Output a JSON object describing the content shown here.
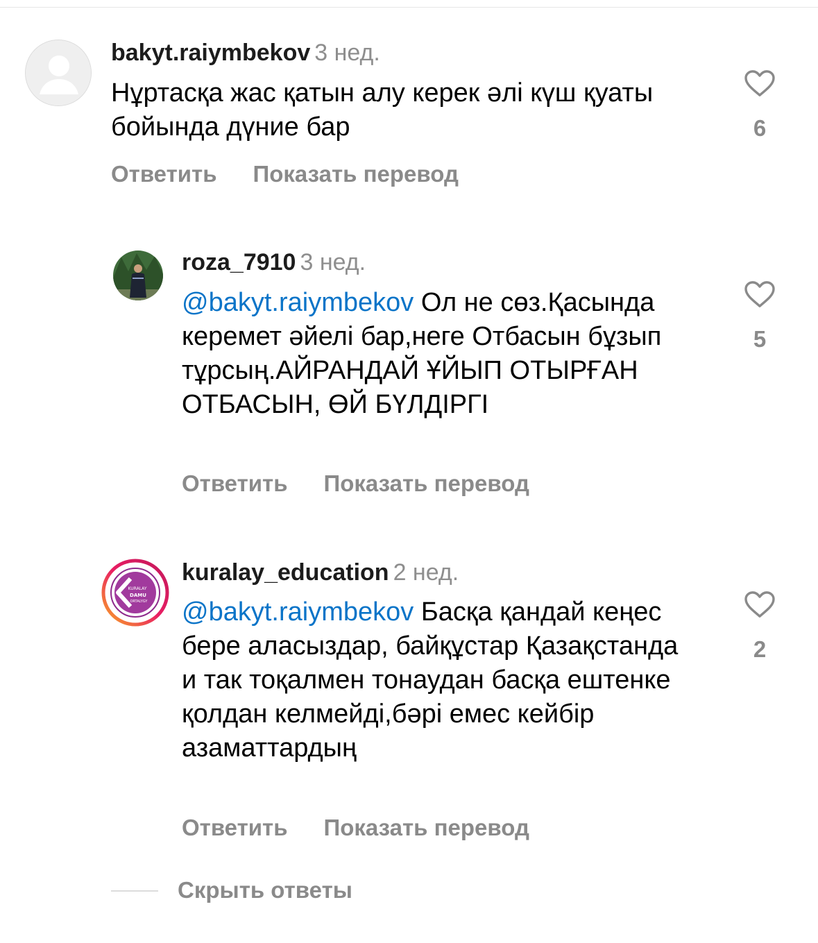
{
  "comments": [
    {
      "username": "bakyt.raiymbekov",
      "time": "3 нед.",
      "mention": "",
      "text": "Нұртасқа жас қатын алу керек әлі күш қуаты бойында дүние бар",
      "likes": "6",
      "reply_label": "Ответить",
      "translate_label": "Показать перевод"
    },
    {
      "username": "roza_7910",
      "time": "3 нед.",
      "mention": "@bakyt.raiymbekov",
      "text": "Ол не сөз.Қасында керемет әйелі бар,неге Отбасын бұзып тұрсың.АЙРАНДАЙ ҰЙЫП ОТЫРҒАН ОТБАСЫН, ӨЙ БҮЛДІРГІ",
      "likes": "5",
      "reply_label": "Ответить",
      "translate_label": "Показать перевод"
    },
    {
      "username": "kuralay_education",
      "time": "2 нед.",
      "mention": "@bakyt.raiymbekov",
      "text": "Басқа қандай кеңес бере аласыздар, байқұстар Қазақстанда и так тоқалмен тонаудан басқа ештенке қолдан келмейді,бәрі емес кейбір азаматтардың",
      "likes": "2",
      "reply_label": "Ответить",
      "translate_label": "Показать перевод",
      "avatar_logo": {
        "line1": "KURALAY",
        "line2": "DAMU",
        "line3": "ORTALYGY"
      }
    }
  ],
  "hide_replies_label": "Скрыть ответы",
  "colors": {
    "mention": "#0a74c8",
    "secondary_text": "#8a8a8a",
    "story_ring_start": "#f9a825",
    "story_ring_end": "#c2185b",
    "logo_purple": "#8e2a8c"
  },
  "icons": {
    "like": "heart-outline-icon",
    "default_avatar": "default-user-avatar-icon"
  }
}
